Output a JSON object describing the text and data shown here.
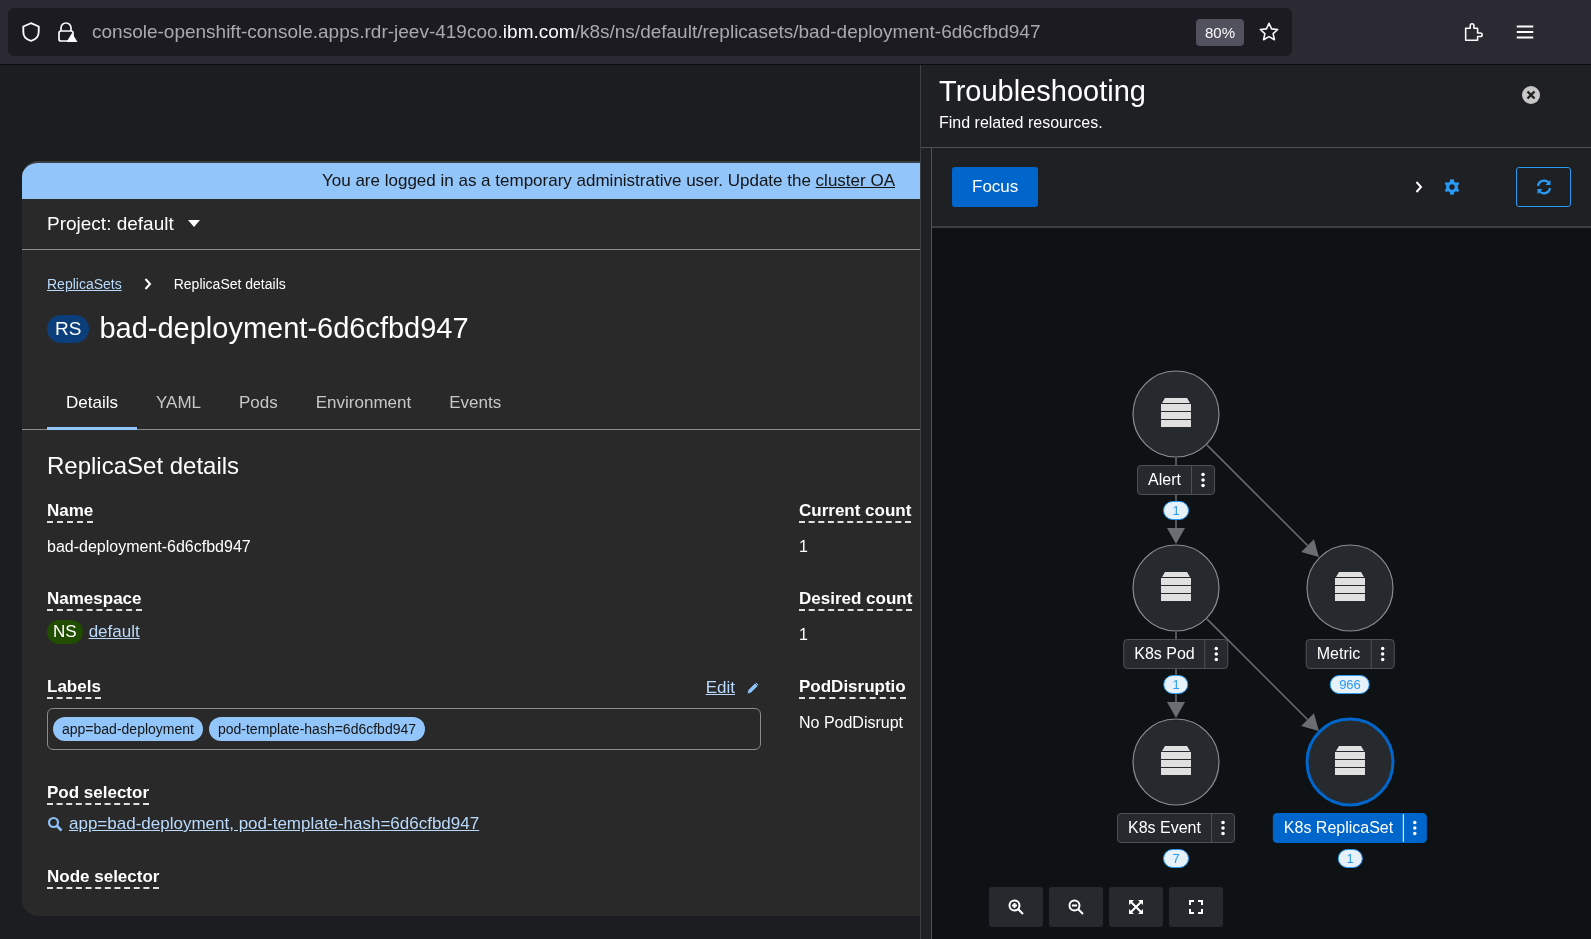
{
  "browser": {
    "url_prefix": "console-openshift-console.apps.rdr-jeev-419coo.",
    "url_domain": "ibm.com",
    "url_path": "/k8s/ns/default/replicasets/bad-deployment-6d6cfbd947",
    "zoom": "80%"
  },
  "banner": {
    "text": "You are logged in as a temporary administrative user. Update the",
    "link": "cluster OA"
  },
  "project": "Project: default",
  "breadcrumb": [
    {
      "label": "ReplicaSets",
      "kind": "link"
    },
    {
      "label": "ReplicaSet details",
      "kind": "current"
    }
  ],
  "title": {
    "badge": "RS",
    "name": "bad-deployment-6d6cfbd947"
  },
  "tabs": [
    {
      "label": "Details",
      "selected": true
    },
    {
      "label": "YAML",
      "selected": false
    },
    {
      "label": "Pods",
      "selected": false
    },
    {
      "label": "Environment",
      "selected": false
    },
    {
      "label": "Events",
      "selected": false
    }
  ],
  "section_title": "ReplicaSet details",
  "fields_left": [
    {
      "kind": "text",
      "label": "Name",
      "value": "bad-deployment-6d6cfbd947"
    },
    {
      "kind": "namespace",
      "label": "Namespace",
      "badge": "NS",
      "value": "default"
    },
    {
      "kind": "labels",
      "label": "Labels",
      "edit": "Edit",
      "chips": [
        "app=bad-deployment",
        "pod-template-hash=6d6cfbd947"
      ]
    },
    {
      "kind": "selector",
      "label": "Pod selector",
      "value": "app=bad-deployment, pod-template-hash=6d6cfbd947"
    },
    {
      "kind": "heading",
      "label": "Node selector"
    }
  ],
  "fields_right": [
    {
      "label": "Current count",
      "value": "1"
    },
    {
      "label": "Desired count",
      "value": "1"
    },
    {
      "label": "PodDisruptio",
      "value": "No PodDisrupt"
    }
  ],
  "drawer": {
    "title": "Troubleshooting",
    "subtitle": "Find related resources.",
    "focus_button": "Focus",
    "nodes": [
      {
        "label": "Alert",
        "selected": false,
        "count": "1"
      },
      {
        "label": "K8s Pod",
        "selected": false,
        "count": "1"
      },
      {
        "label": "Metric",
        "selected": false,
        "count": "966"
      },
      {
        "label": "K8s Event",
        "selected": false,
        "count": "7"
      },
      {
        "label": "K8s ReplicaSet",
        "selected": true,
        "count": "1"
      }
    ]
  }
}
